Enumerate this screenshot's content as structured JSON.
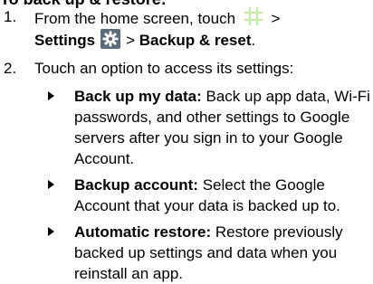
{
  "heading": "To back up & restore:",
  "steps": [
    {
      "number": "1.",
      "prefix": "From the home screen, touch",
      "sep1": ">",
      "settings_label": "Settings",
      "sep2": ">",
      "backup_label": "Backup & reset",
      "suffix": "."
    },
    {
      "number": "2.",
      "text": "Touch an option to access its settings:"
    }
  ],
  "options": [
    {
      "title": "Back up my data:",
      "description": "Back up app data, Wi-Fi passwords, and other settings to Google servers after you sign in to your Google Account."
    },
    {
      "title": "Backup account:",
      "description": "Select the Google Account that your data is backed up to."
    },
    {
      "title": "Automatic restore:",
      "description": "Restore previously backed up settings and data when you reinstall an app."
    }
  ],
  "icons": {
    "apps": "apps-grid-icon",
    "settings": "settings-gear-icon"
  },
  "colors": {
    "apps_grid": "#c5e8a4",
    "settings_bg": "#5a6b7a"
  }
}
